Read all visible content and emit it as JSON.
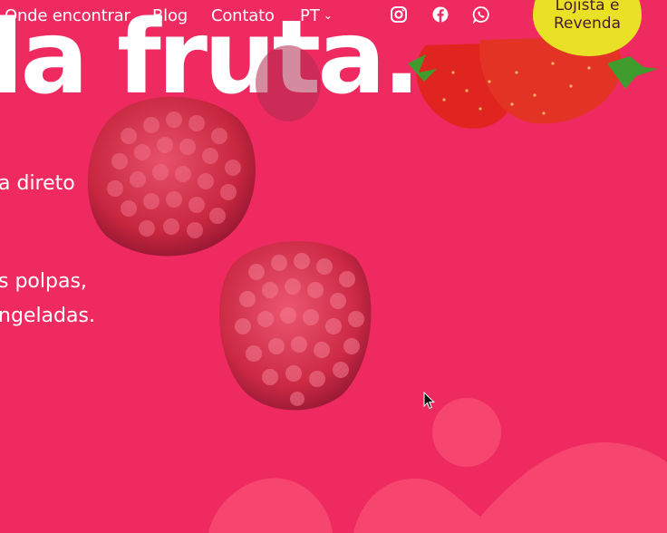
{
  "nav": {
    "links": [
      "Onde encontrar",
      "Blog",
      "Contato"
    ],
    "language": "PT",
    "social": [
      "instagram-icon",
      "facebook-icon",
      "whatsapp-icon"
    ],
    "reseller_line1": "Lojista e",
    "reseller_line2": "Revenda"
  },
  "hero": {
    "headline": "la fruta.",
    "paragraph_lines": [
      "a direto",
      "s polpas,",
      "ngeladas."
    ]
  },
  "colors": {
    "background": "#ee2a60",
    "accent_yellow": "#e8e126",
    "blob_pink": "#f6466f",
    "raspberry": "#d8334f",
    "strawberry": "#e0241f",
    "leaf": "#3f9b2c"
  }
}
